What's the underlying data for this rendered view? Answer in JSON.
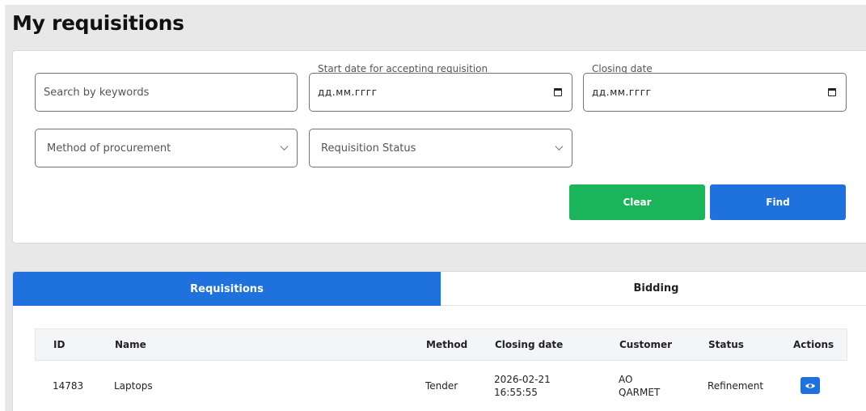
{
  "page": {
    "title": "My requisitions"
  },
  "filters": {
    "search": {
      "placeholder": "Search by keywords"
    },
    "start_date": {
      "label": "Start date for accepting requisition",
      "value": "дд.мм.гггг",
      "icon": "calendar-icon"
    },
    "closing_date": {
      "label": "Closing date",
      "value": "дд.мм.гггг",
      "icon": "calendar-icon"
    },
    "method": {
      "placeholder": "Method of procurement",
      "icon": "chevron-down-icon"
    },
    "status": {
      "placeholder": "Requisition Status",
      "icon": "chevron-down-icon"
    },
    "clear_label": "Clear",
    "find_label": "Find"
  },
  "tabs": [
    {
      "label": "Requisitions",
      "active": true
    },
    {
      "label": "Bidding",
      "active": false
    }
  ],
  "table": {
    "columns": [
      "ID",
      "Name",
      "Method",
      "Closing date",
      "Customer",
      "Status",
      "Actions"
    ],
    "rows": [
      {
        "id": "14783",
        "name": "Laptops",
        "method": "Tender",
        "closing_date_line1": "2026-02-21",
        "closing_date_line2": "16:55:55",
        "customer_line1": "AO",
        "customer_line2": "QARMET",
        "status": "Refinement",
        "action_icon": "eye-icon"
      }
    ]
  },
  "colors": {
    "primary": "#1f72de",
    "success": "#1ab45a",
    "background": "#e8e8e8"
  }
}
